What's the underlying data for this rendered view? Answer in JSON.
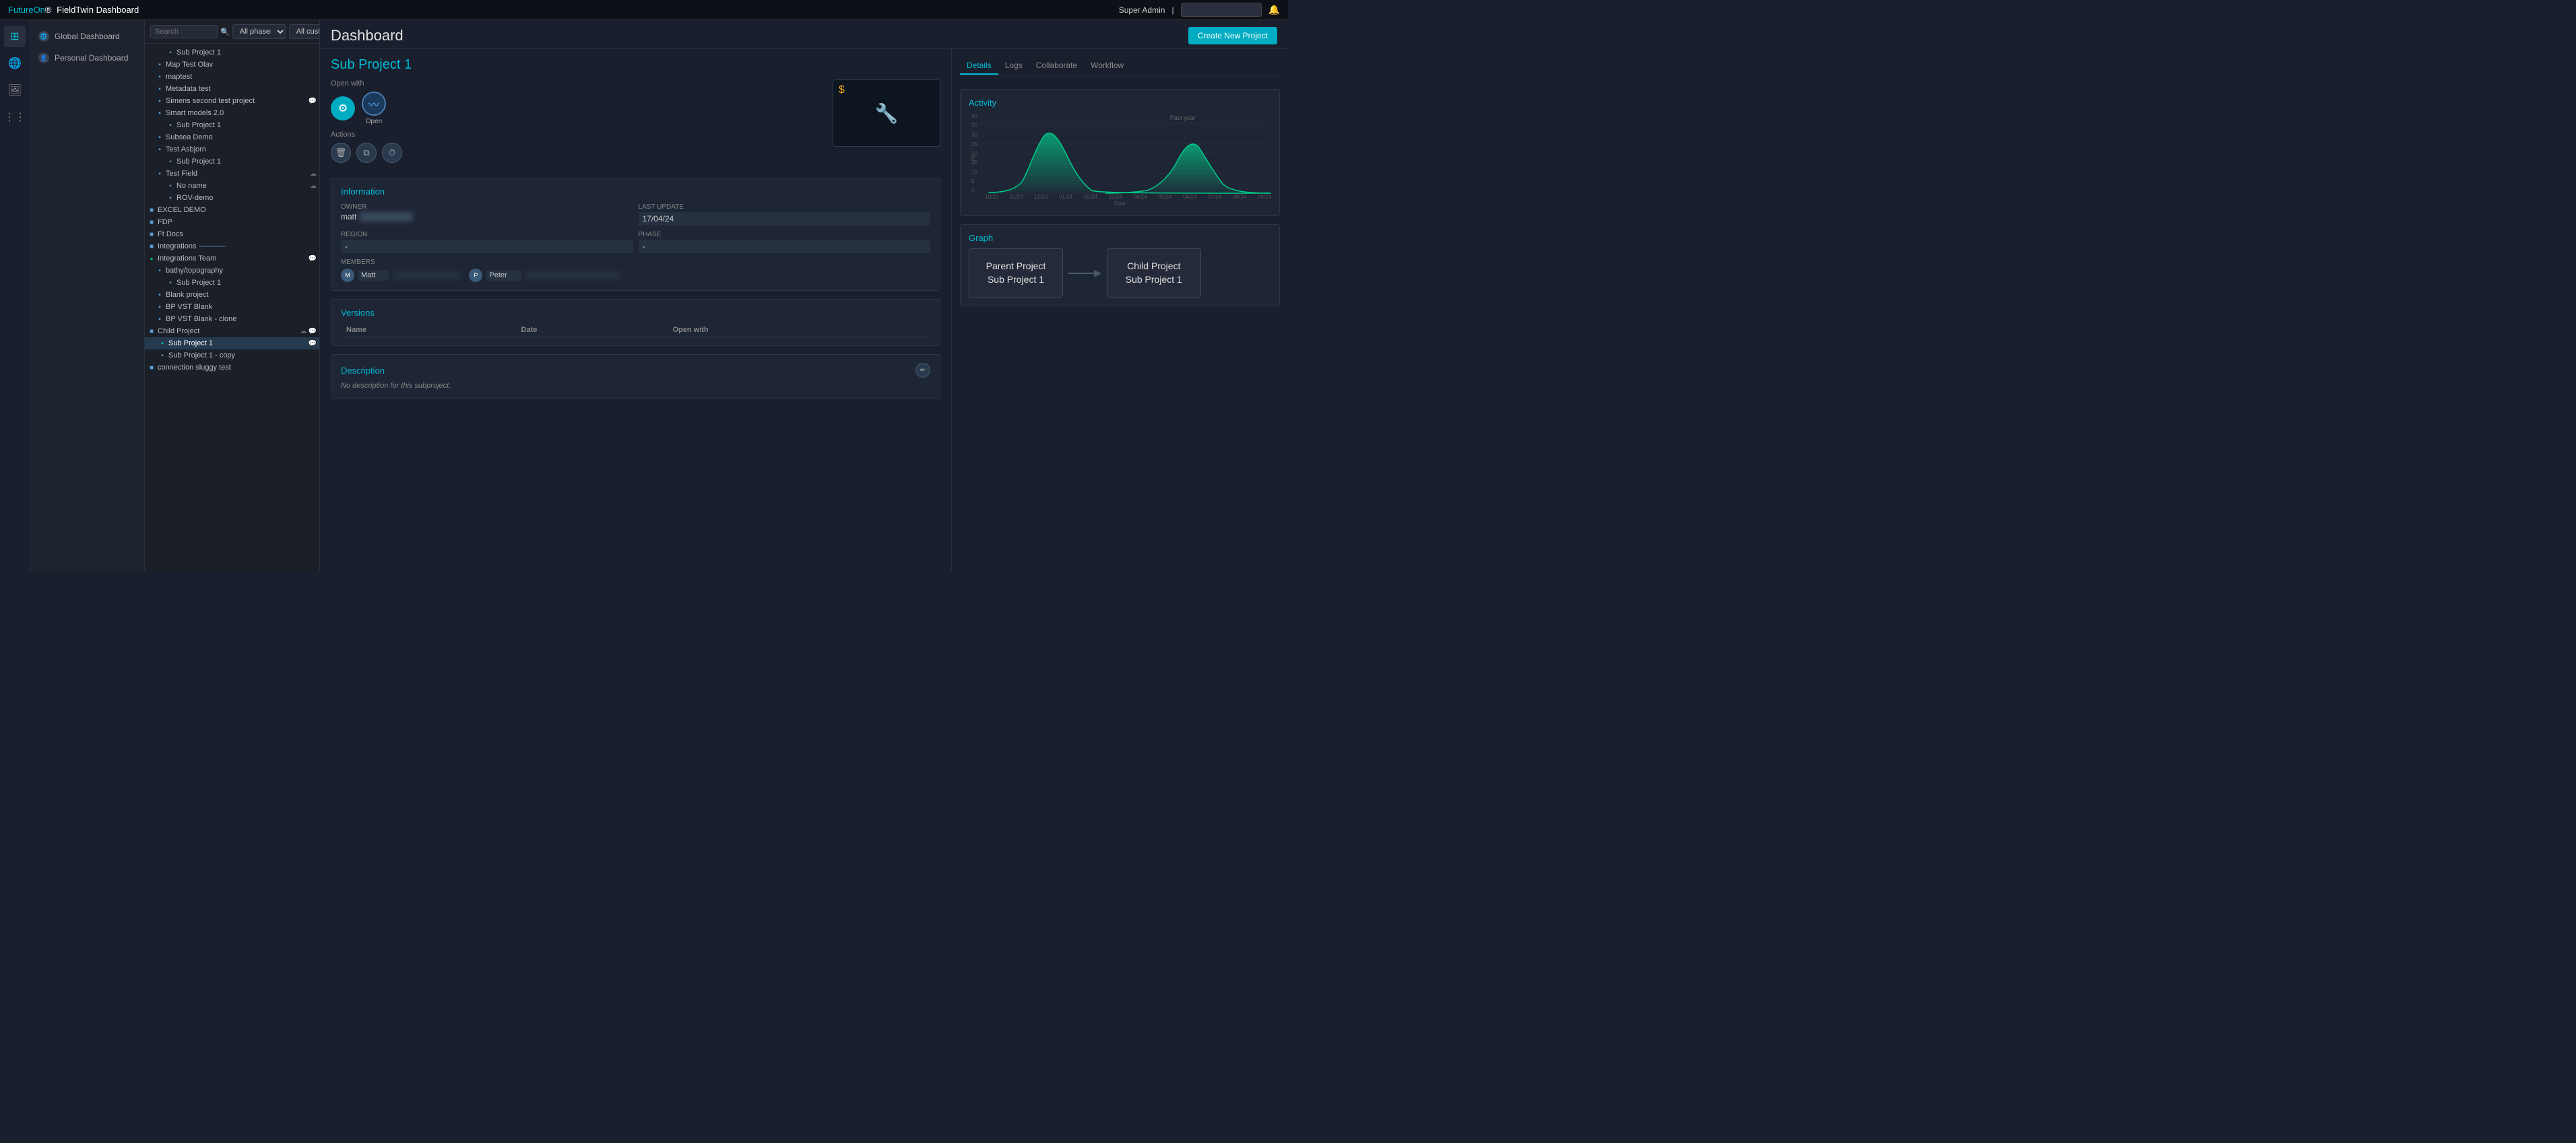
{
  "topbar": {
    "brand": "FutureOn",
    "app_name": "FieldTwin Dashboard",
    "user": "Super Admin",
    "search_placeholder": ""
  },
  "nav_sidebar": {
    "items": [
      {
        "id": "global-dashboard",
        "label": "Global Dashboard",
        "icon": "🌐"
      },
      {
        "id": "personal-dashboard",
        "label": "Personal Dashboard",
        "icon": "👤"
      }
    ]
  },
  "tree_toolbar": {
    "search_placeholder": "Search",
    "filter_label": "All phases",
    "customers_label": "All customers"
  },
  "tree": {
    "nodes": [
      {
        "level": 2,
        "label": "Sub Project 1",
        "type": "sub",
        "selected": false
      },
      {
        "level": 1,
        "label": "Map Test Olav",
        "type": "project",
        "selected": false
      },
      {
        "level": 1,
        "label": "maptest",
        "type": "project",
        "selected": false
      },
      {
        "level": 1,
        "label": "Metadata test",
        "type": "project",
        "selected": false
      },
      {
        "level": 1,
        "label": "Simens second test project",
        "type": "project",
        "selected": false,
        "has_action": true
      },
      {
        "level": 1,
        "label": "Smart models 2.0",
        "type": "project",
        "selected": false
      },
      {
        "level": 2,
        "label": "Sub Project 1",
        "type": "sub",
        "selected": false
      },
      {
        "level": 1,
        "label": "Subsea Demo",
        "type": "project",
        "selected": false
      },
      {
        "level": 1,
        "label": "Test Asbjorn",
        "type": "project",
        "selected": false
      },
      {
        "level": 2,
        "label": "Sub Project 1",
        "type": "sub",
        "selected": false
      },
      {
        "level": 1,
        "label": "Test Field",
        "type": "project",
        "selected": false,
        "has_action": true
      },
      {
        "level": 2,
        "label": "No name",
        "type": "sub",
        "selected": false,
        "has_action": true
      },
      {
        "level": 2,
        "label": "ROV-demo",
        "type": "sub",
        "selected": false
      },
      {
        "level": 0,
        "label": "EXCEL DEMO",
        "type": "root",
        "selected": false
      },
      {
        "level": 0,
        "label": "FDP",
        "type": "root",
        "selected": false
      },
      {
        "level": 0,
        "label": "Ft Docs",
        "type": "root",
        "selected": false
      },
      {
        "level": 0,
        "label": "Integrations",
        "type": "root-highlight",
        "selected": false
      },
      {
        "level": 0,
        "label": "Integrations Team",
        "type": "root",
        "selected": false,
        "has_action": true
      },
      {
        "level": 1,
        "label": "bathy/topography",
        "type": "project",
        "selected": false
      },
      {
        "level": 2,
        "label": "Sub Project 1",
        "type": "sub",
        "selected": false
      },
      {
        "level": 1,
        "label": "Blank project",
        "type": "project",
        "selected": false
      },
      {
        "level": 1,
        "label": "BP VST Blank",
        "type": "project",
        "selected": false
      },
      {
        "level": 1,
        "label": "BP VST Blank - clone",
        "type": "project",
        "selected": false
      },
      {
        "level": 0,
        "label": "Child Project",
        "type": "root",
        "selected": false,
        "has_action": true
      },
      {
        "level": 1,
        "label": "Sub Project 1",
        "type": "sub-selected",
        "selected": true,
        "has_action": true
      },
      {
        "level": 1,
        "label": "Sub Project 1 - copy",
        "type": "project",
        "selected": false
      },
      {
        "level": 0,
        "label": "connection sluggy test",
        "type": "root",
        "selected": false
      }
    ]
  },
  "main": {
    "title": "Dashboard",
    "create_btn_label": "Create New Project"
  },
  "detail_tabs": {
    "items": [
      "Details",
      "Logs",
      "Collaborate",
      "Workflow"
    ],
    "active": "Details"
  },
  "project": {
    "title": "Sub Project 1",
    "open_with_label": "Open with",
    "actions_label": "Actions",
    "info": {
      "title": "Information",
      "owner_label": "OWNER",
      "owner_value": "matt",
      "last_update_label": "LAST UPDATE",
      "last_update_value": "17/04/24",
      "region_label": "REGION",
      "region_value": "-",
      "phase_label": "PHASE",
      "phase_value": "-",
      "members_label": "MEMBERS",
      "member1_name": "Matt",
      "member2_name": "Peter"
    },
    "versions": {
      "title": "Versions",
      "col_name": "Name",
      "col_date": "Date",
      "col_open": "Open with",
      "rows": []
    },
    "description": {
      "title": "Description",
      "text": "No description for this subproject."
    }
  },
  "activity": {
    "title": "Activity",
    "past_label": "Past year",
    "y_labels": [
      "40",
      "35",
      "30",
      "25",
      "20",
      "15",
      "10",
      "5",
      "0"
    ],
    "x_labels": [
      "10/23",
      "11/23",
      "12/23",
      "01/24",
      "02/24",
      "03/24",
      "04/24",
      "05/24",
      "06/24",
      "07/24",
      "08/24",
      "09/24"
    ],
    "x_axis_label": "Date",
    "log_label": "Log"
  },
  "graph": {
    "title": "Graph",
    "parent_label": "Parent Project\nSub Project 1",
    "parent_line1": "Parent Project",
    "parent_line2": "Sub Project 1",
    "child_label": "Child Project\nSub Project 1",
    "child_line1": "Child Project",
    "child_line2": "Sub Project 1"
  },
  "icons": {
    "chevron_left": "❮❮",
    "globe": "🌐",
    "person": "👤",
    "gear": "⚙",
    "wave": "〰",
    "trash": "🗑",
    "copy": "⧉",
    "clock": "⏱",
    "pencil": "✏",
    "cloud": "☁",
    "chat": "💬",
    "search": "🔍",
    "filter": "▼",
    "bell": "🔔",
    "folder": "📁",
    "file": "📄",
    "arrow_right": "→"
  }
}
